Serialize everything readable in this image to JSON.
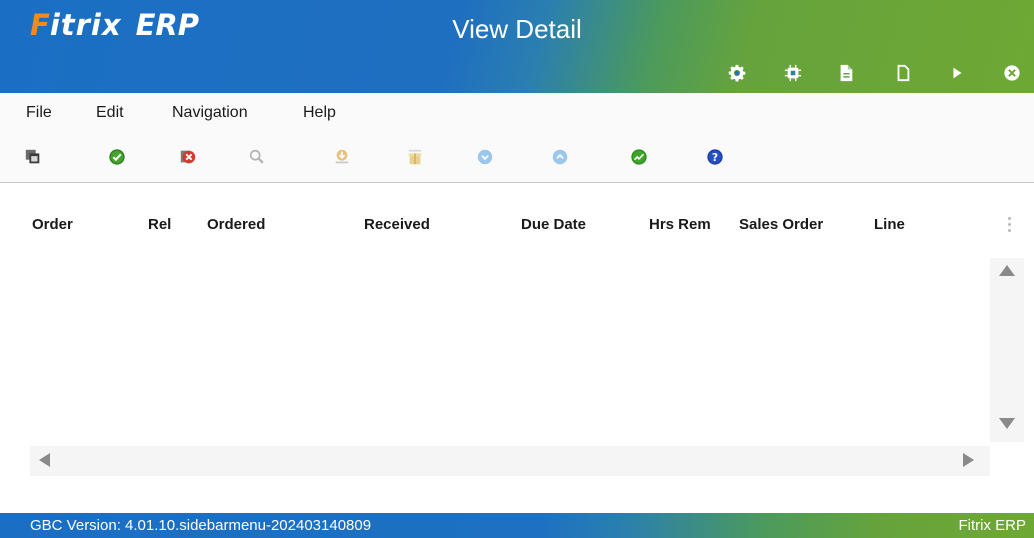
{
  "header": {
    "logo": {
      "f": "F",
      "rest": "itrix",
      "erp": "ERP"
    },
    "title": "View Detail",
    "icons": [
      "gear-icon",
      "chip-icon",
      "document-lines-icon",
      "document-icon",
      "play-icon",
      "close-circle-icon"
    ]
  },
  "menu": {
    "items": [
      {
        "label": "File"
      },
      {
        "label": "Edit"
      },
      {
        "label": "Navigation"
      },
      {
        "label": "Help"
      }
    ]
  },
  "toolbar": {
    "tools": [
      "copy-window-icon",
      "accept-check-icon",
      "cancel-x-icon",
      "zoom-icon",
      "download-icon",
      "gift-icon",
      "scroll-down-icon",
      "scroll-up-icon",
      "green-trend-icon",
      "help-icon"
    ]
  },
  "table": {
    "columns": [
      {
        "label": "Order"
      },
      {
        "label": "Rel"
      },
      {
        "label": "Ordered"
      },
      {
        "label": "Received"
      },
      {
        "label": "Due Date"
      },
      {
        "label": "Hrs Rem"
      },
      {
        "label": "Sales Order"
      },
      {
        "label": "Line"
      }
    ],
    "rows": []
  },
  "footer": {
    "version": "GBC Version: 4.01.10.sidebarmenu-202403140809",
    "brand": "Fitrix ERP"
  },
  "colors": {
    "header_blue": "#1a6fc4",
    "header_green": "#6ea834",
    "logo_orange": "#f28a1e"
  }
}
